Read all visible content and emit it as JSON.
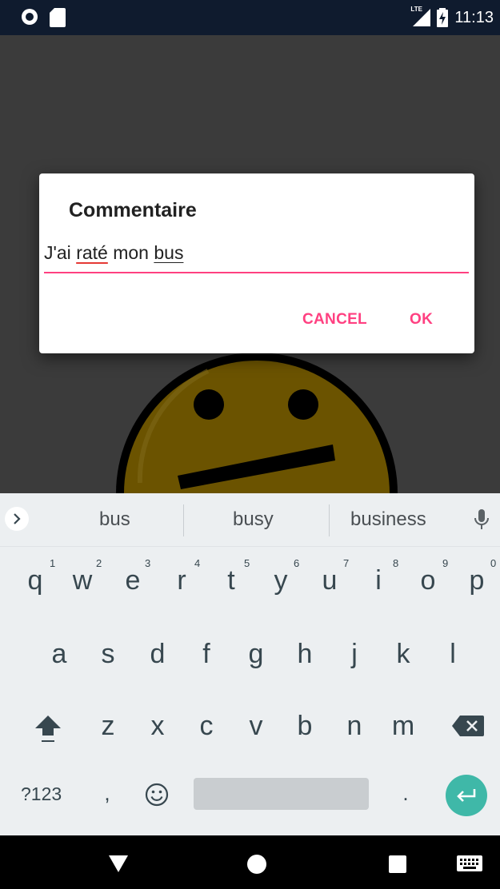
{
  "status_bar": {
    "time": "11:13",
    "network": "LTE",
    "icons": [
      "circle-notification-icon",
      "sd-card-icon",
      "signal-icon",
      "battery-charging-icon"
    ]
  },
  "dialog": {
    "title": "Commentaire",
    "input_words": [
      "J'ai",
      "raté",
      "mon",
      "bus"
    ],
    "cancel_label": "CANCEL",
    "ok_label": "OK"
  },
  "keyboard": {
    "suggestions": [
      "bus",
      "busy",
      "business"
    ],
    "row1": [
      "q",
      "w",
      "e",
      "r",
      "t",
      "y",
      "u",
      "i",
      "o",
      "p"
    ],
    "row1_hints": [
      "1",
      "2",
      "3",
      "4",
      "5",
      "6",
      "7",
      "8",
      "9",
      "0"
    ],
    "row2": [
      "a",
      "s",
      "d",
      "f",
      "g",
      "h",
      "j",
      "k",
      "l"
    ],
    "row3": [
      "z",
      "x",
      "c",
      "v",
      "b",
      "n",
      "m"
    ],
    "symbols_label": "?123",
    "comma": ",",
    "period": "."
  },
  "colors": {
    "accent": "#ff4081",
    "enter_key": "#3fb8a8",
    "smiley_fill": "#6b5300"
  }
}
